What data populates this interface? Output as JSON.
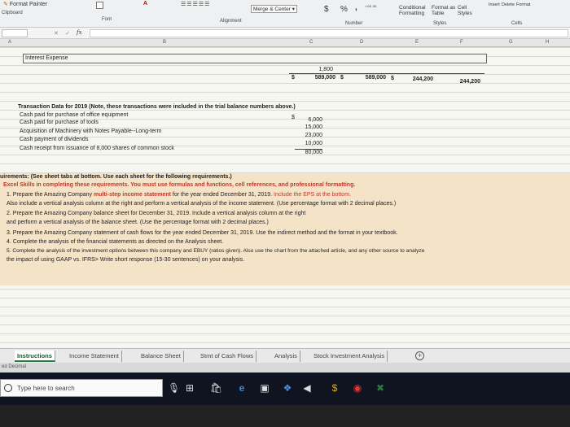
{
  "ribbon": {
    "format_painter": "Format Painter",
    "clipboard": "Clipboard",
    "font": "Font",
    "alignment": "Alignment",
    "merge_center": "Merge & Center",
    "currency": "$",
    "percent": "%",
    "comma": ",",
    "number": "Number",
    "conditional_formatting": "Conditional Formatting",
    "format_as_table": "Format as Table",
    "cell_styles": "Cell Styles",
    "styles": "Styles",
    "insert": "Insert",
    "delete": "Delete",
    "format": "Format",
    "cells": "Cells"
  },
  "formula_bar": {
    "fx": "fx",
    "cancel": "✕",
    "enter": "✓"
  },
  "columns": [
    "A",
    "B",
    "C",
    "D",
    "E",
    "F",
    "G",
    "H"
  ],
  "rows": {
    "interest_expense_label": "Interest Expense",
    "interest_value": "1,800",
    "total_row": [
      {
        "cur": "$",
        "val": "589,000"
      },
      {
        "cur": "$",
        "val": "589,000"
      },
      {
        "cur": "$",
        "val": "244,200"
      },
      {
        "cur": "",
        "val": "244,200"
      }
    ]
  },
  "transactions": {
    "title": "Transaction Data for 2019 (Note, these transactions were included in the trial balance numbers above.)",
    "items": [
      {
        "label": "Cash paid for purchase of office equipment",
        "cur": "$",
        "value": "6,000"
      },
      {
        "label": "Cash paid for purchase of tools",
        "cur": "",
        "value": "15,000"
      },
      {
        "label": "Acquisition of Machinery with Notes Payable--Long-term",
        "cur": "",
        "value": "23,000"
      },
      {
        "label": "Cash payment of dividends",
        "cur": "",
        "value": "10,000"
      },
      {
        "label": "Cash receipt from issuance of 8,000 shares of common stock",
        "cur": "",
        "value": "80,000"
      }
    ]
  },
  "requirements": {
    "heading": "uirements: (See sheet tabs at bottom. Use each sheet for the following requirements.)",
    "excel_skills": "Excel Skills in completing these requirements.  You must use formulas and functions, cell references, and professional formatting.",
    "items": [
      {
        "pre": "1. Prepare the Amazing Company ",
        "bold": "multi-step income statement",
        "post": " for the year ended December 31, 2019.  ",
        "red": "Include the EPS at the bottom."
      },
      {
        "pre": "    Also include a vertical analysis column at the right and perform a vertical analysis of the income statement. (Use percentage format with 2 decimal places.)",
        "bold": "",
        "post": "",
        "red": ""
      },
      {
        "pre": "2. Prepare the Amazing Company balance sheet for December 31, 2019. Include a vertical analysis column at the right",
        "bold": "",
        "post": "",
        "red": ""
      },
      {
        "pre": "    and perform a vertical analysis of the balance sheet. (Use the percentage format with 2 decimal places.)",
        "bold": "",
        "post": "",
        "red": ""
      },
      {
        "pre": "3. Prepare the Amazing Company statement of cash flows for the year ended December 31, 2019.  Use the indirect method and the format in your textbook.",
        "bold": "",
        "post": "",
        "red": ""
      },
      {
        "pre": "4. Complete the analysis of the financial statements as directed on the Analysis sheet.",
        "bold": "",
        "post": "",
        "red": ""
      },
      {
        "pre": "5. Complete the analysis of the investment options between this company and EBUY (ratios given). Also use the chart from the attached article, and any other source to analyze",
        "bold": "",
        "post": "",
        "red": ""
      },
      {
        "pre": "    the impact of using GAAP vs. IFRS> Write short response (15-30 sentences) on your analysis.",
        "bold": "",
        "post": "",
        "red": ""
      }
    ]
  },
  "tabs": [
    "Instructions",
    "Income Statement",
    "Balance Sheet",
    "Stmt of Cash Flows",
    "Analysis",
    "Stock Investment Analysis"
  ],
  "active_tab": "Instructions",
  "add_tab": "+",
  "status": "ed Decimal",
  "taskbar": {
    "search_placeholder": "Type here to search"
  },
  "colors": {
    "accent": "#2b7a3d",
    "band": "#f5e3c8",
    "link_red": "#c0392b"
  }
}
